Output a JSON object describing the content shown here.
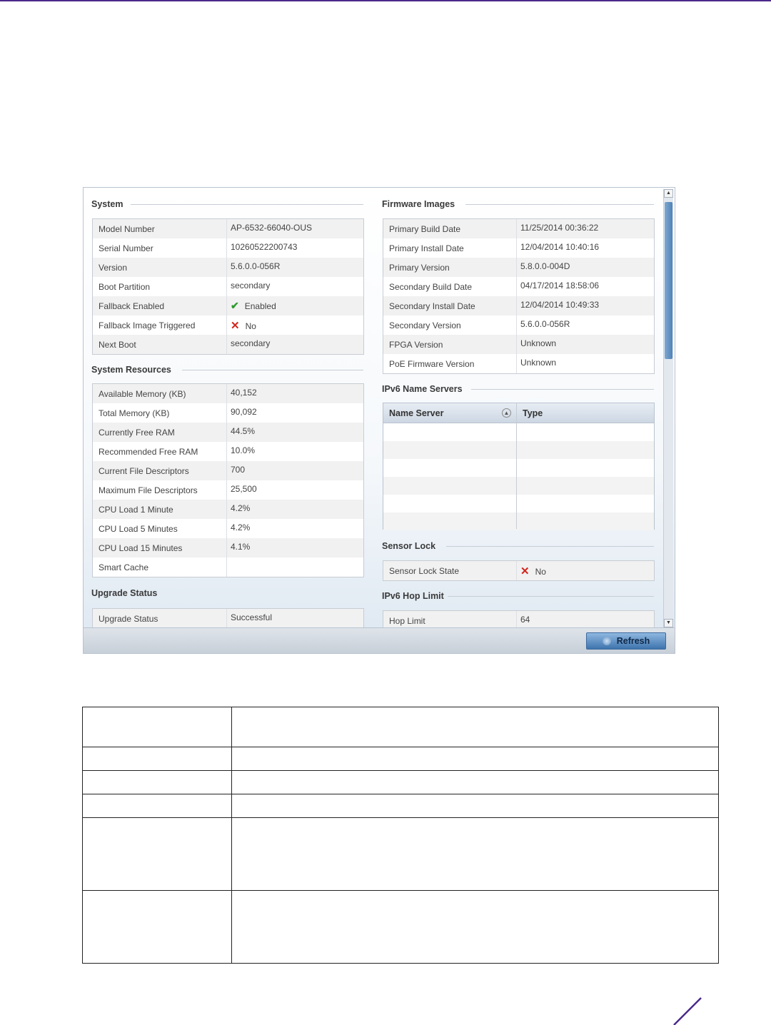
{
  "system": {
    "title": "System",
    "rows": [
      {
        "label": "Model Number",
        "value": "AP-6532-66040-OUS"
      },
      {
        "label": "Serial Number",
        "value": "10260522200743"
      },
      {
        "label": "Version",
        "value": "5.6.0.0-056R"
      },
      {
        "label": "Boot Partition",
        "value": "secondary"
      },
      {
        "label": "Fallback Enabled",
        "value": "Enabled",
        "icon": "check-icon"
      },
      {
        "label": "Fallback Image Triggered",
        "value": "No",
        "icon": "x-icon"
      },
      {
        "label": "Next Boot",
        "value": "secondary"
      }
    ]
  },
  "system_resources": {
    "title": "System Resources",
    "rows": [
      {
        "label": "Available Memory (KB)",
        "value": "40,152"
      },
      {
        "label": "Total Memory (KB)",
        "value": "90,092"
      },
      {
        "label": "Currently Free RAM",
        "value": "44.5%"
      },
      {
        "label": "Recommended Free RAM",
        "value": "10.0%"
      },
      {
        "label": "Current File Descriptors",
        "value": "700"
      },
      {
        "label": "Maximum File Descriptors",
        "value": "25,500"
      },
      {
        "label": "CPU Load 1 Minute",
        "value": "4.2%"
      },
      {
        "label": "CPU Load 5 Minutes",
        "value": "4.2%"
      },
      {
        "label": "CPU Load 15 Minutes",
        "value": "4.1%"
      },
      {
        "label": "Smart Cache",
        "value": ""
      }
    ]
  },
  "upgrade": {
    "title": "Upgrade Status",
    "rows": [
      {
        "label": "Upgrade Status",
        "value": "Successful"
      }
    ]
  },
  "firmware": {
    "title": "Firmware Images",
    "rows": [
      {
        "label": "Primary Build Date",
        "value": "11/25/2014 00:36:22"
      },
      {
        "label": "Primary Install Date",
        "value": "12/04/2014 10:40:16"
      },
      {
        "label": "Primary Version",
        "value": "5.8.0.0-004D"
      },
      {
        "label": "Secondary Build Date",
        "value": "04/17/2014 18:58:06"
      },
      {
        "label": "Secondary Install Date",
        "value": "12/04/2014 10:49:33"
      },
      {
        "label": "Secondary Version",
        "value": "5.6.0.0-056R"
      },
      {
        "label": "FPGA Version",
        "value": "Unknown"
      },
      {
        "label": "PoE Firmware Version",
        "value": "Unknown"
      }
    ]
  },
  "ipv6_name_servers": {
    "title": "IPv6 Name Servers",
    "columns": [
      "Name Server",
      "Type"
    ]
  },
  "sensor_lock": {
    "title": "Sensor Lock",
    "rows": [
      {
        "label": "Sensor Lock State",
        "value": "No",
        "icon": "x-icon"
      }
    ]
  },
  "ipv6_hop_limit": {
    "title": "IPv6 Hop Limit",
    "rows": [
      {
        "label": "Hop Limit",
        "value": "64"
      }
    ]
  },
  "buttons": {
    "refresh": "Refresh"
  },
  "colors": {
    "accent_purple": "#4b2a8a",
    "check_green": "#2f9a2f",
    "x_red": "#d0261c",
    "button_blue": "#3e74ad"
  }
}
